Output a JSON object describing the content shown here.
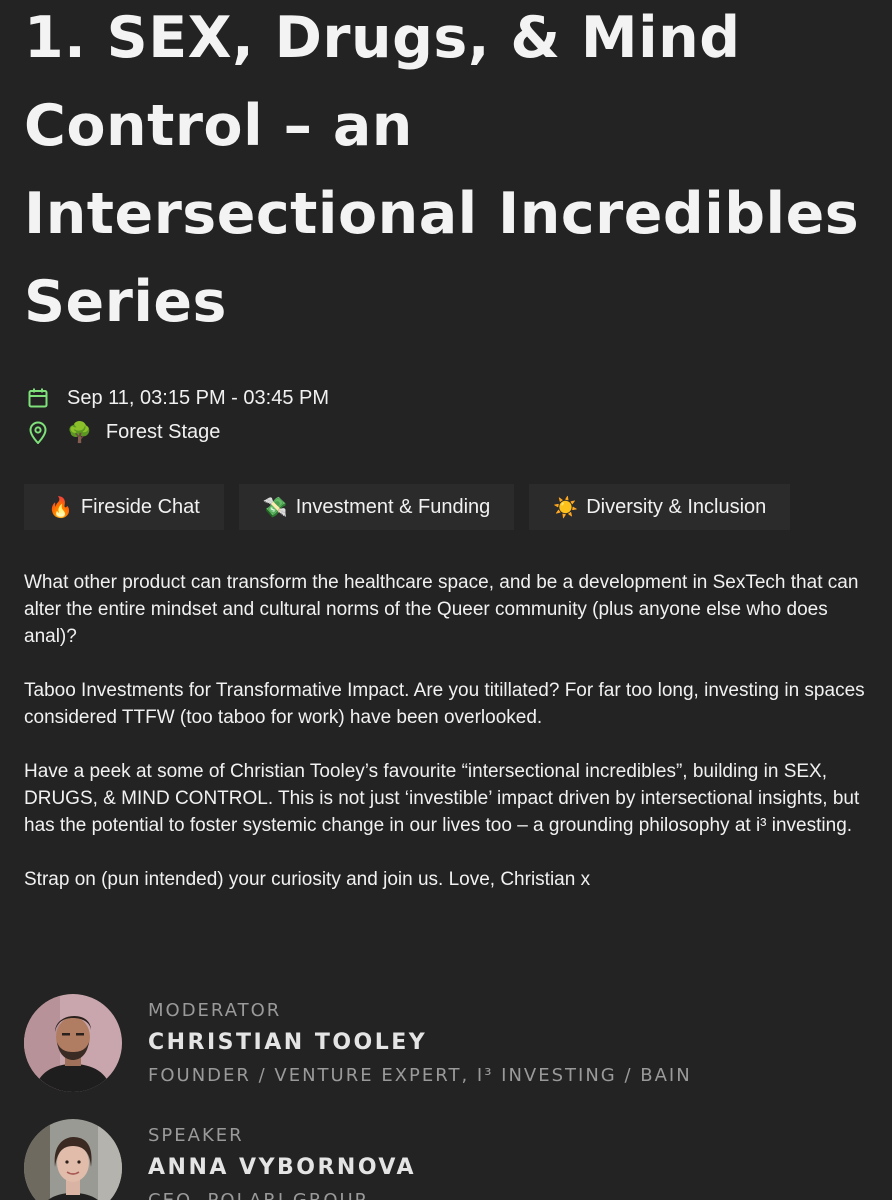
{
  "session": {
    "title": "1. SEX, Drugs, & Mind Control – an Intersectional Incredibles Series",
    "datetime": "Sep 11, 03:15 PM - 03:45 PM",
    "location_emoji": "🌳",
    "location": "Forest Stage",
    "icons": {
      "calendar": "calendar-icon",
      "location": "map-pin-icon"
    },
    "accent_color": "#7ee17a"
  },
  "tags": [
    {
      "emoji": "🔥",
      "label": "Fireside Chat"
    },
    {
      "emoji": "💸",
      "label": "Investment & Funding"
    },
    {
      "emoji": "☀️",
      "label": "Diversity & Inclusion"
    }
  ],
  "description": [
    "What other product can transform the healthcare space, and be a development in SexTech that can alter the entire mindset and cultural norms of the Queer community (plus anyone else who does anal)?",
    "Taboo Investments for Transformative Impact. Are you titillated? For far too long, investing in spaces considered TTFW (too taboo for work) have been overlooked.",
    "Have a peek at some of Christian Tooley’s favourite “intersectional incredibles”, building in SEX, DRUGS, & MIND CONTROL. This is not just ‘investible’ impact driven by intersectional insights, but has the potential to foster systemic change in our lives too – a grounding philosophy at i³ investing.",
    "Strap on (pun intended) your curiosity and join us. Love, Christian x"
  ],
  "people": [
    {
      "role": "Moderator",
      "name": "Christian Tooley",
      "affiliation": "Founder / Venture Expert, i³ Investing / Bain"
    },
    {
      "role": "Speaker",
      "name": "Anna Vybornova",
      "affiliation": "CEO, Polari Group"
    }
  ]
}
